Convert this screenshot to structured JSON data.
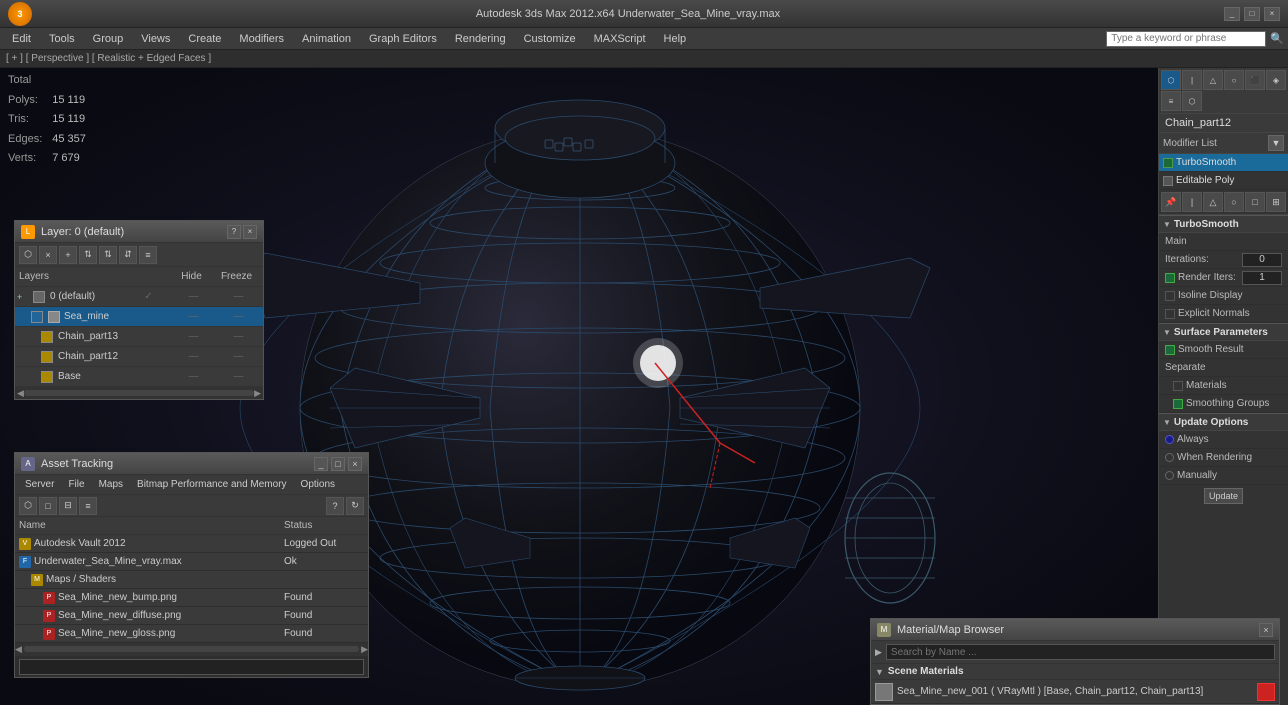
{
  "window": {
    "title": "Autodesk 3ds Max 2012.x64    Underwater_Sea_Mine_vray.max",
    "close_label": "×",
    "minimize_label": "_",
    "maximize_label": "□"
  },
  "menu": {
    "items": [
      "Edit",
      "Tools",
      "Group",
      "Views",
      "Create",
      "Modifiers",
      "Animation",
      "Graph Editors",
      "Rendering",
      "Customize",
      "MAXScript",
      "Help"
    ]
  },
  "search": {
    "placeholder": "Type a keyword or phrase"
  },
  "breadcrumb": {
    "text": "[ + ] [ Perspective ] [ Realistic + Edged Faces ]"
  },
  "stats": {
    "polys_label": "Polys:",
    "polys_value": "15 119",
    "tris_label": "Tris:",
    "tris_value": "15 119",
    "edges_label": "Edges:",
    "edges_value": "45 357",
    "verts_label": "Verts:",
    "verts_value": "7 679",
    "total_label": "Total"
  },
  "layers_panel": {
    "title": "Layer: 0 (default)",
    "help_btn": "?",
    "close_btn": "×",
    "columns": {
      "name": "Layers",
      "hide": "Hide",
      "freeze": "Freeze"
    },
    "rows": [
      {
        "indent": 0,
        "check": "✓",
        "icon": "default",
        "name": "0 (default)",
        "hide": "—",
        "freeze": "—"
      },
      {
        "indent": 1,
        "check": "",
        "icon": "blue",
        "name": "Sea_mine",
        "hide": "—",
        "freeze": "—"
      },
      {
        "indent": 2,
        "check": "",
        "icon": "yellow",
        "name": "Chain_part13",
        "hide": "—",
        "freeze": "—"
      },
      {
        "indent": 2,
        "check": "",
        "icon": "yellow",
        "name": "Chain_part12",
        "hide": "—",
        "freeze": "—"
      },
      {
        "indent": 2,
        "check": "",
        "icon": "yellow",
        "name": "Base",
        "hide": "—",
        "freeze": "—"
      }
    ]
  },
  "asset_panel": {
    "title": "Asset Tracking",
    "menu_items": [
      "Server",
      "File",
      "Maps",
      "Bitmap Performance and Memory",
      "Options"
    ],
    "columns": {
      "name": "Name",
      "status": "Status"
    },
    "rows": [
      {
        "indent": 0,
        "icon": "yellow",
        "name": "Autodesk Vault 2012",
        "status": "Logged Out"
      },
      {
        "indent": 0,
        "icon": "blue",
        "name": "Underwater_Sea_Mine_vray.max",
        "status": "Ok"
      },
      {
        "indent": 1,
        "icon": "yellow",
        "name": "Maps / Shaders",
        "status": ""
      },
      {
        "indent": 2,
        "icon": "red",
        "name": "Sea_Mine_new_bump.png",
        "status": "Found"
      },
      {
        "indent": 2,
        "icon": "red",
        "name": "Sea_Mine_new_diffuse.png",
        "status": "Found"
      },
      {
        "indent": 2,
        "icon": "red",
        "name": "Sea_Mine_new_gloss.png",
        "status": "Found"
      }
    ]
  },
  "right_panel": {
    "object_name": "Chain_part12",
    "modifier_list_label": "Modifier List",
    "modifiers": [
      {
        "name": "TurboSmooth",
        "selected": true
      },
      {
        "name": "Editable Poly",
        "selected": false
      }
    ],
    "turbosmooth": {
      "title": "TurboSmooth",
      "main_label": "Main",
      "iterations_label": "Iterations:",
      "iterations_value": "0",
      "render_iters_label": "Render Iters:",
      "render_iters_value": "1",
      "isoline_label": "Isoline Display",
      "explicit_label": "Explicit Normals"
    },
    "surface_params": {
      "title": "Surface Parameters",
      "smooth_result_label": "Smooth Result",
      "separate_label": "Separate",
      "materials_label": "Materials",
      "smoothing_groups_label": "Smoothing Groups"
    },
    "update_options": {
      "title": "Update Options",
      "always_label": "Always",
      "when_rendering_label": "When Rendering",
      "manually_label": "Manually",
      "update_btn": "Update"
    }
  },
  "material_browser": {
    "title": "Material/Map Browser",
    "close_btn": "×",
    "search_placeholder": "Search by Name ...",
    "scene_materials_label": "Scene Materials",
    "materials": [
      {
        "name": "Sea_Mine_new_001 ( VRayMtl ) [Base, Chain_part12, Chain_part13]",
        "swatch_color": "#cc2222"
      }
    ]
  }
}
